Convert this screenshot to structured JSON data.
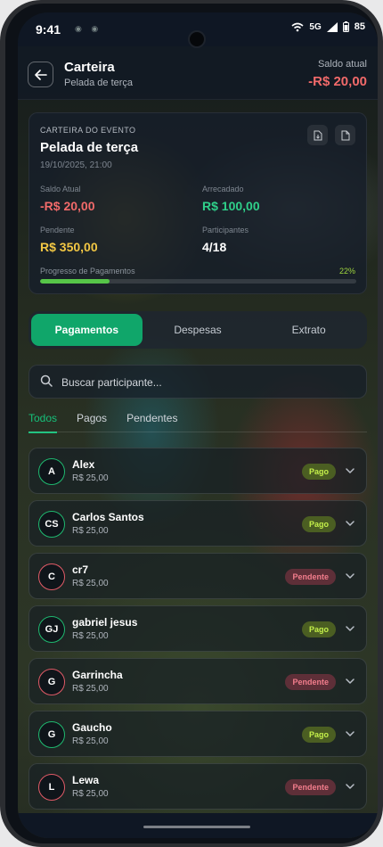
{
  "status_bar": {
    "time": "9:41",
    "network": "5G",
    "battery": "85"
  },
  "header": {
    "title": "Carteira",
    "subtitle": "Pelada de terça",
    "saldo_label": "Saldo atual",
    "saldo_value": "-R$ 20,00"
  },
  "event_card": {
    "label": "CARTEIRA DO EVENTO",
    "title": "Pelada de terça",
    "date": "19/10/2025, 21:00",
    "stats": {
      "saldo_label": "Saldo Atual",
      "saldo_value": "-R$ 20,00",
      "arrecadado_label": "Arrecadado",
      "arrecadado_value": "R$ 100,00",
      "pendente_label": "Pendente",
      "pendente_value": "R$ 350,00",
      "participantes_label": "Participantes",
      "participantes_value": "4/18"
    },
    "progress_label": "Progresso de Pagamentos",
    "progress_pct": "22%",
    "progress_fraction": 0.22
  },
  "tabs": [
    {
      "label": "Pagamentos",
      "active": true
    },
    {
      "label": "Despesas",
      "active": false
    },
    {
      "label": "Extrato",
      "active": false
    }
  ],
  "search": {
    "placeholder": "Buscar participante..."
  },
  "filters": [
    {
      "label": "Todos",
      "active": true
    },
    {
      "label": "Pagos",
      "active": false
    },
    {
      "label": "Pendentes",
      "active": false
    }
  ],
  "participants": [
    {
      "initials": "A",
      "name": "Alex",
      "amount": "R$ 25,00",
      "status": "Pago",
      "paid": true
    },
    {
      "initials": "CS",
      "name": "Carlos Santos",
      "amount": "R$ 25,00",
      "status": "Pago",
      "paid": true
    },
    {
      "initials": "C",
      "name": "cr7",
      "amount": "R$ 25,00",
      "status": "Pendente",
      "paid": false
    },
    {
      "initials": "GJ",
      "name": "gabriel jesus",
      "amount": "R$ 25,00",
      "status": "Pago",
      "paid": true
    },
    {
      "initials": "G",
      "name": "Garrincha",
      "amount": "R$ 25,00",
      "status": "Pendente",
      "paid": false
    },
    {
      "initials": "G",
      "name": "Gaucho",
      "amount": "R$ 25,00",
      "status": "Pago",
      "paid": true
    },
    {
      "initials": "L",
      "name": "Lewa",
      "amount": "R$ 25,00",
      "status": "Pendente",
      "paid": false
    }
  ],
  "colors": {
    "accent_green": "#10a66a",
    "negative_red": "#f26a6a",
    "positive_green": "#2fd08a",
    "pending_yellow": "#f2c744"
  }
}
